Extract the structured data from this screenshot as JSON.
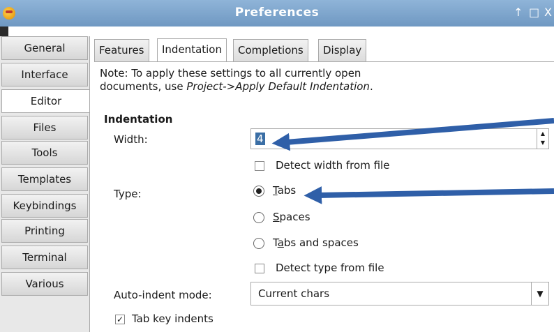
{
  "window": {
    "title": "Preferences",
    "controls": [
      "↑",
      "□",
      "X"
    ]
  },
  "sidebar": {
    "items": [
      {
        "label": "General"
      },
      {
        "label": "Interface"
      },
      {
        "label": "Editor"
      },
      {
        "label": "Files"
      },
      {
        "label": "Tools"
      },
      {
        "label": "Templates"
      },
      {
        "label": "Keybindings"
      },
      {
        "label": "Printing"
      },
      {
        "label": "Terminal"
      },
      {
        "label": "Various"
      }
    ],
    "active": "Editor"
  },
  "tabs": [
    "Features",
    "Indentation",
    "Completions",
    "Display"
  ],
  "active_tab": "Indentation",
  "note": {
    "line1": "Note: To apply these settings to all currently open",
    "line2_prefix": "documents, use ",
    "line2_italic": "Project->Apply Default Indentation",
    "line2_suffix": "."
  },
  "indentation": {
    "heading": "Indentation",
    "width_label": "Width:",
    "width_value": "4",
    "detect_width_label": "Detect width from file",
    "detect_width_checked": false,
    "type_label": "Type:",
    "type_options": [
      {
        "label_u": "T",
        "label_rest": "abs",
        "selected": true
      },
      {
        "label_u": "S",
        "label_rest": "paces",
        "selected": false
      },
      {
        "label_pre": "T",
        "label_u": "a",
        "label_rest": "bs and spaces",
        "selected": false
      }
    ],
    "detect_type_label": "Detect type from file",
    "detect_type_checked": false,
    "auto_indent_label": "Auto-indent mode:",
    "auto_indent_value": "Current chars",
    "tab_key_label": "Tab key indents",
    "tab_key_checked": true
  },
  "annotation_color": "#2f5fa8"
}
